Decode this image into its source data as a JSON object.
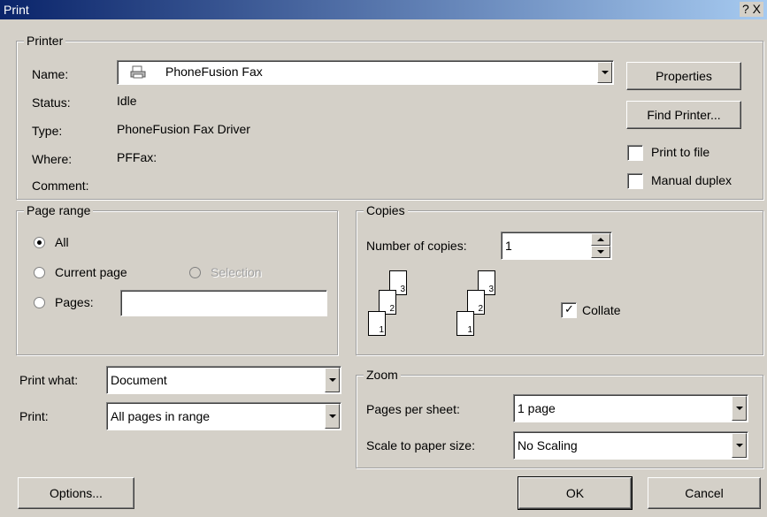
{
  "window": {
    "title": "Print",
    "help_glyph": "?",
    "close_glyph": "X"
  },
  "printer": {
    "legend": "Printer",
    "name_label": "Name:",
    "name_value": "PhoneFusion Fax",
    "status_label": "Status:",
    "status_value": "Idle",
    "type_label": "Type:",
    "type_value": "PhoneFusion Fax Driver",
    "where_label": "Where:",
    "where_value": "PFFax:",
    "comment_label": "Comment:",
    "comment_value": "",
    "properties_button": "Properties",
    "find_printer_button": "Find Printer...",
    "print_to_file_label": "Print to file",
    "print_to_file_checked": false,
    "manual_duplex_label": "Manual duplex",
    "manual_duplex_checked": false
  },
  "page_range": {
    "legend": "Page range",
    "all_label": "All",
    "current_page_label": "Current page",
    "selection_label": "Selection",
    "pages_label": "Pages:",
    "pages_value": "",
    "selected": "all"
  },
  "copies": {
    "legend": "Copies",
    "number_label": "Number of copies:",
    "number_value": "1",
    "collate_label": "Collate",
    "collate_checked": true,
    "page_numbers": [
      "1",
      "2",
      "3"
    ]
  },
  "print_what": {
    "label": "Print what:",
    "value": "Document"
  },
  "print": {
    "label": "Print:",
    "value": "All pages in range"
  },
  "zoom": {
    "legend": "Zoom",
    "pages_per_sheet_label": "Pages per sheet:",
    "pages_per_sheet_value": "1 page",
    "scale_label": "Scale to paper size:",
    "scale_value": "No Scaling"
  },
  "buttons": {
    "options": "Options...",
    "ok": "OK",
    "cancel": "Cancel"
  },
  "icons": {
    "printer": "printer-icon",
    "check": "✓"
  }
}
